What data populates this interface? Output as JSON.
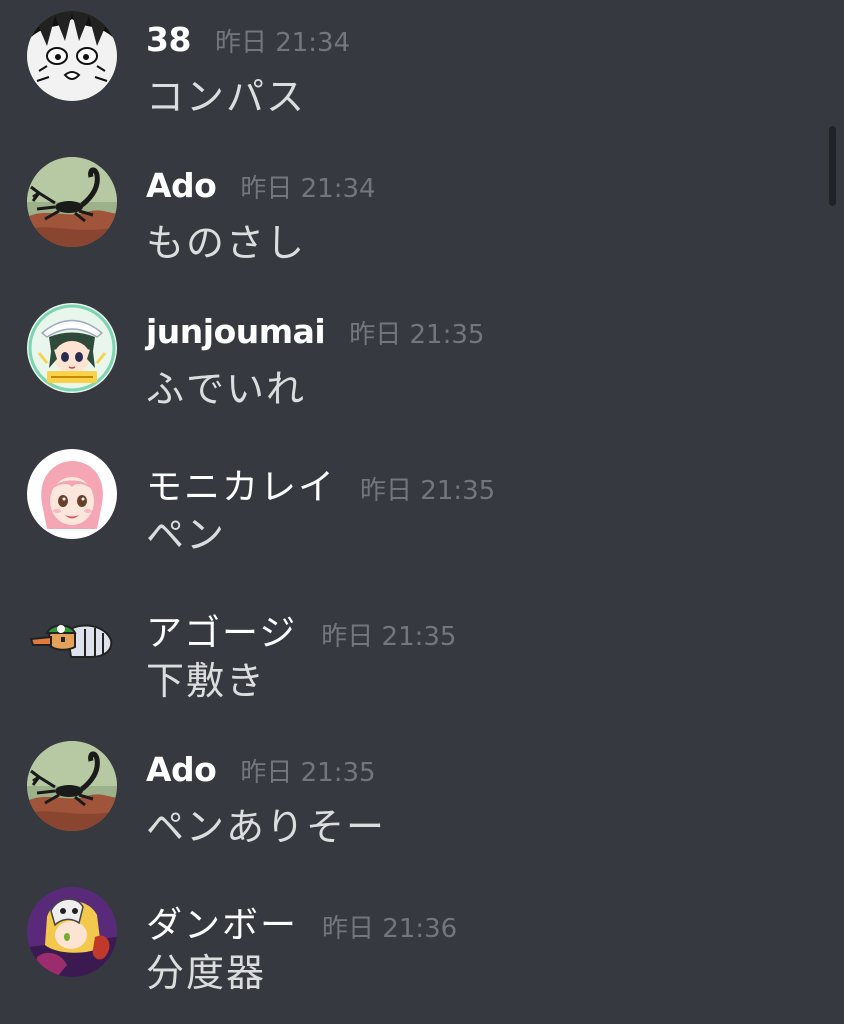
{
  "messages": [
    {
      "author": "38",
      "timestamp": "昨日 21:34",
      "content": "コンパス",
      "avatar_icon": "manga-face-avatar"
    },
    {
      "author": "Ado",
      "timestamp": "昨日 21:34",
      "content": "ものさし",
      "avatar_icon": "scorpion-avatar"
    },
    {
      "author": "junjoumai",
      "timestamp": "昨日 21:35",
      "content": "ふでいれ",
      "avatar_icon": "anime-girl-hat-avatar"
    },
    {
      "author": "モニカレイ",
      "timestamp": "昨日 21:35",
      "content": "ペン",
      "avatar_icon": "pink-hair-girl-avatar"
    },
    {
      "author": "アゴージ",
      "timestamp": "昨日 21:35",
      "content": "下敷き",
      "avatar_icon": "pixel-creature-avatar"
    },
    {
      "author": "Ado",
      "timestamp": "昨日 21:35",
      "content": "ペンありそー",
      "avatar_icon": "scorpion-avatar"
    },
    {
      "author": "ダンボー",
      "timestamp": "昨日 21:36",
      "content": "分度器",
      "avatar_icon": "masked-character-avatar"
    }
  ],
  "colors": {
    "background": "#36393f",
    "username": "#ffffff",
    "timestamp": "#72767d",
    "message_text": "#dcddde"
  }
}
